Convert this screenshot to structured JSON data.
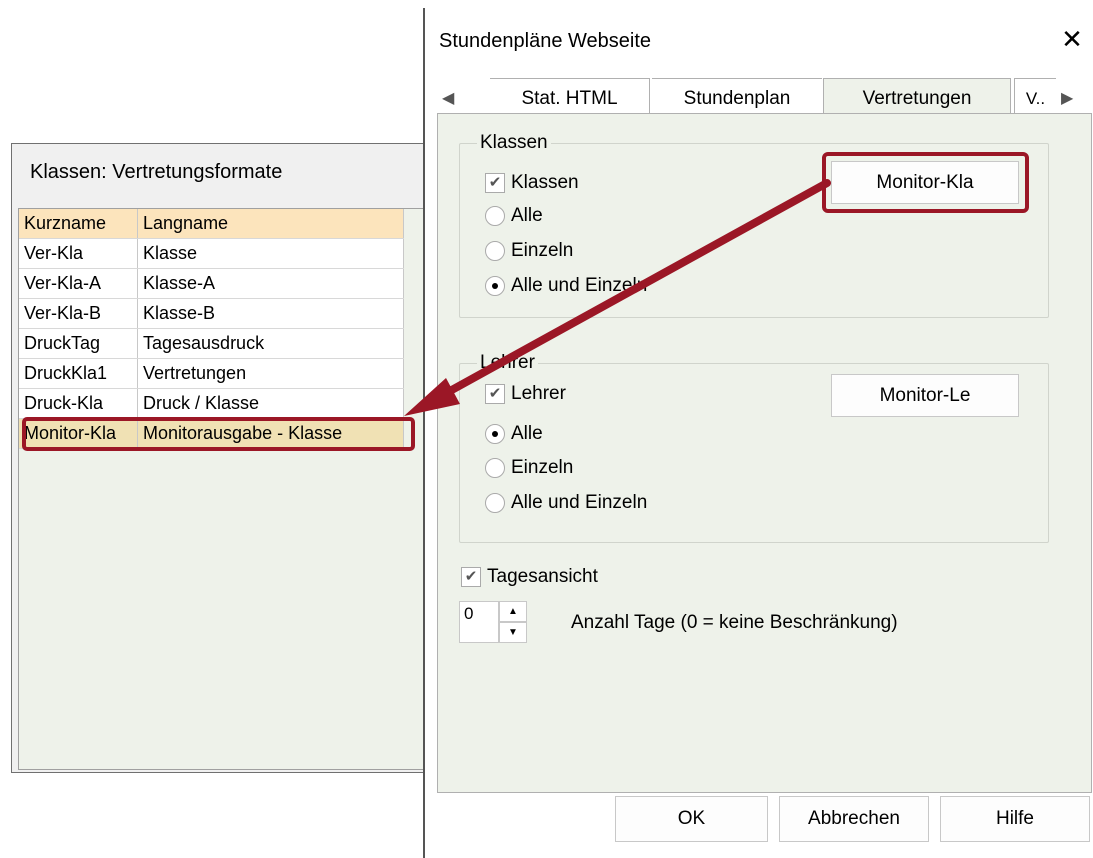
{
  "left_window": {
    "title": "Klassen: Vertretungsformate",
    "columns": [
      "Kurzname",
      "Langname"
    ],
    "rows": [
      [
        "Ver-Kla",
        "Klasse"
      ],
      [
        "Ver-Kla-A",
        "Klasse-A"
      ],
      [
        "Ver-Kla-B",
        "Klasse-B"
      ],
      [
        "DruckTag",
        "Tagesausdruck"
      ],
      [
        "DruckKla1",
        "Vertretungen"
      ],
      [
        "Druck-Kla",
        "Druck / Klasse"
      ],
      [
        "Monitor-Kla",
        "Monitorausgabe - Klasse"
      ]
    ]
  },
  "dialog": {
    "title": "Stundenpläne Webseite",
    "close_icon": "close-icon",
    "tabs": [
      "Stat. HTML",
      "Stundenplan",
      "Vertretungen",
      "V.."
    ],
    "active_tab": "Vertretungen",
    "klassen": {
      "group": "Klassen",
      "checkbox": "Klassen",
      "options": [
        "Alle",
        "Einzeln",
        "Alle und Einzeln"
      ],
      "selected": "Alle und Einzeln",
      "button": "Monitor-Kla"
    },
    "lehrer": {
      "group": "Lehrer",
      "checkbox": "Lehrer",
      "options": [
        "Alle",
        "Einzeln",
        "Alle und Einzeln"
      ],
      "selected": "Alle",
      "button": "Monitor-Le"
    },
    "tagesansicht": "Tagesansicht",
    "anzahl_value": "0",
    "anzahl_label": "Anzahl Tage (0 = keine Beschränkung)",
    "buttons": {
      "ok": "OK",
      "cancel": "Abbrechen",
      "help": "Hilfe"
    }
  },
  "colors": {
    "annotation": "#9b1726",
    "panel_bg": "#eef2ea",
    "header_bg": "#fce4bc"
  }
}
